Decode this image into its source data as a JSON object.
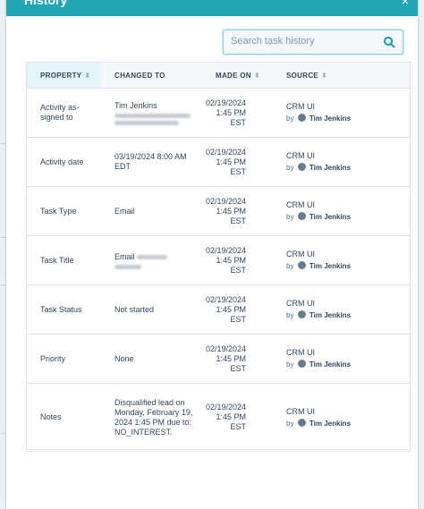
{
  "modal": {
    "title": "History",
    "close_glyph": "×"
  },
  "search": {
    "placeholder": "Search task history"
  },
  "table": {
    "columns": [
      "PROPERTY",
      "CHANGED TO",
      "MADE ON",
      "SOURCE"
    ],
    "rows": [
      {
        "property": "Activity as-signed to",
        "changed_to": "Tim Jenkins",
        "made_on": [
          "02/19/2024",
          "1:45 PM",
          "EST"
        ],
        "source": "CRM UI",
        "by": "by",
        "user": "Tim Jenkins"
      },
      {
        "property": "Activity date",
        "changed_to": "03/19/2024 8:00 AM EDT",
        "made_on": [
          "02/19/2024",
          "1:45 PM",
          "EST"
        ],
        "source": "CRM UI",
        "by": "by",
        "user": "Tim Jenkins"
      },
      {
        "property": "Task Type",
        "changed_to": "Email",
        "made_on": [
          "02/19/2024",
          "1:45 PM",
          "EST"
        ],
        "source": "CRM UI",
        "by": "by",
        "user": "Tim Jenkins"
      },
      {
        "property": "Task Title",
        "changed_to": "Email",
        "made_on": [
          "02/19/2024",
          "1:45 PM",
          "EST"
        ],
        "source": "CRM UI",
        "by": "by",
        "user": "Tim Jenkins"
      },
      {
        "property": "Task Status",
        "changed_to": "Not started",
        "made_on": [
          "02/19/2024",
          "1:45 PM",
          "EST"
        ],
        "source": "CRM UI",
        "by": "by",
        "user": "Tim Jenkins"
      },
      {
        "property": "Priority",
        "changed_to": "None",
        "made_on": [
          "02/19/2024",
          "1:45 PM",
          "EST"
        ],
        "source": "CRM UI",
        "by": "by",
        "user": "Tim Jenkins"
      },
      {
        "property": "Notes",
        "changed_to": "Disqualified lead on Monday, February 19, 2024 1:45 PM due to: NO_INTEREST.",
        "made_on": [
          "02/19/2024",
          "1:45 PM",
          "EST"
        ],
        "source": "CRM UI",
        "by": "by",
        "user": "Tim Jenkins"
      }
    ]
  },
  "colors": {
    "header": "#22a8b4",
    "accent": "#00a4bd",
    "text": "#33475b"
  }
}
